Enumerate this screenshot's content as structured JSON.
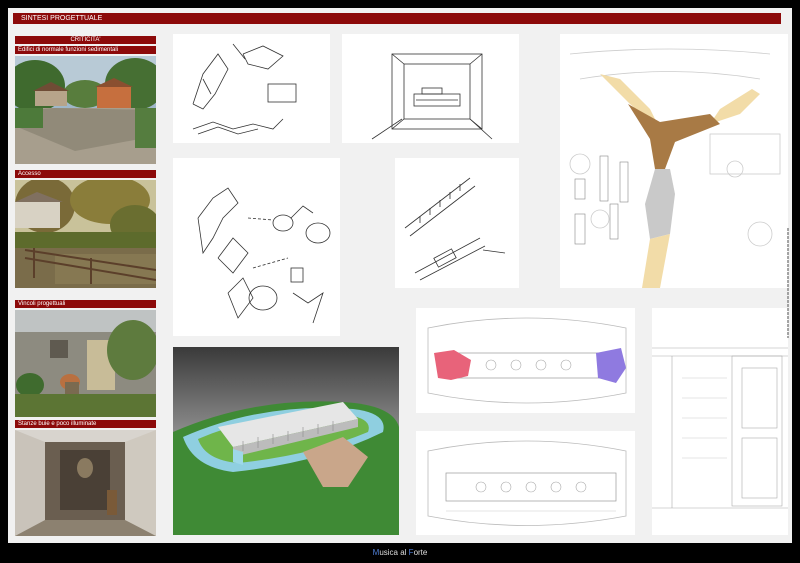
{
  "header": {
    "title": "SINTESI PROGETTUALE"
  },
  "left_column": {
    "heading": "CRITICITA'",
    "items": [
      {
        "label": "Edifici di normale funzioni sedimentali"
      },
      {
        "label": "Accesso"
      },
      {
        "label": "Vincoli progettuali"
      },
      {
        "label": "Stanze buie e poco illuminate"
      }
    ]
  },
  "footer": {
    "brand_part1": "M",
    "brand_part2": "usica al ",
    "brand_part3": "F",
    "brand_part4": "orte"
  },
  "colors": {
    "accent": "#8c0a0a",
    "brand_blue": "#4f7fd8",
    "plan_pink": "#e8637a",
    "plan_violet": "#8f7ae0",
    "plan_brown": "#a87a45",
    "plan_sand": "#f2dca8",
    "lawn_green": "#3f8a35",
    "water_blue": "#8fcfe0"
  }
}
